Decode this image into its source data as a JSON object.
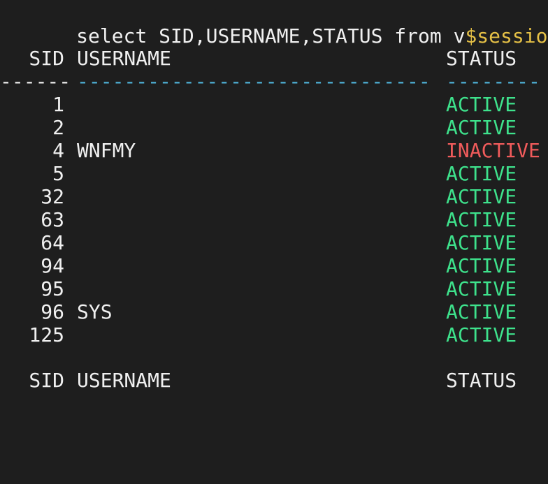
{
  "query": {
    "prefix": "select SID,USERNAME,STATUS from v",
    "highlighted": "$session",
    "suffix": ";"
  },
  "table": {
    "headers": {
      "sid": "SID",
      "username": "USERNAME",
      "status": "STATUS"
    },
    "separators": {
      "sid": "------",
      "username": "------------------------------",
      "status": "--------"
    },
    "rows": [
      {
        "sid": "1",
        "username": "",
        "status": "ACTIVE"
      },
      {
        "sid": "2",
        "username": "",
        "status": "ACTIVE"
      },
      {
        "sid": "4",
        "username": "WNFMY",
        "status": "INACTIVE"
      },
      {
        "sid": "5",
        "username": "",
        "status": "ACTIVE"
      },
      {
        "sid": "32",
        "username": "",
        "status": "ACTIVE"
      },
      {
        "sid": "63",
        "username": "",
        "status": "ACTIVE"
      },
      {
        "sid": "64",
        "username": "",
        "status": "ACTIVE"
      },
      {
        "sid": "94",
        "username": "",
        "status": "ACTIVE"
      },
      {
        "sid": "95",
        "username": "",
        "status": "ACTIVE"
      },
      {
        "sid": "96",
        "username": "SYS",
        "status": "ACTIVE"
      },
      {
        "sid": "125",
        "username": "",
        "status": "ACTIVE"
      }
    ],
    "repeated_headers": {
      "sid": "SID",
      "username": "USERNAME",
      "status": "STATUS"
    }
  },
  "colors": {
    "background": "#1e1e1e",
    "text": "#f0f0f0",
    "active": "#3ee28c",
    "inactive": "#f05b5b",
    "separator": "#4fb3d9",
    "highlight": "#e5c046"
  }
}
